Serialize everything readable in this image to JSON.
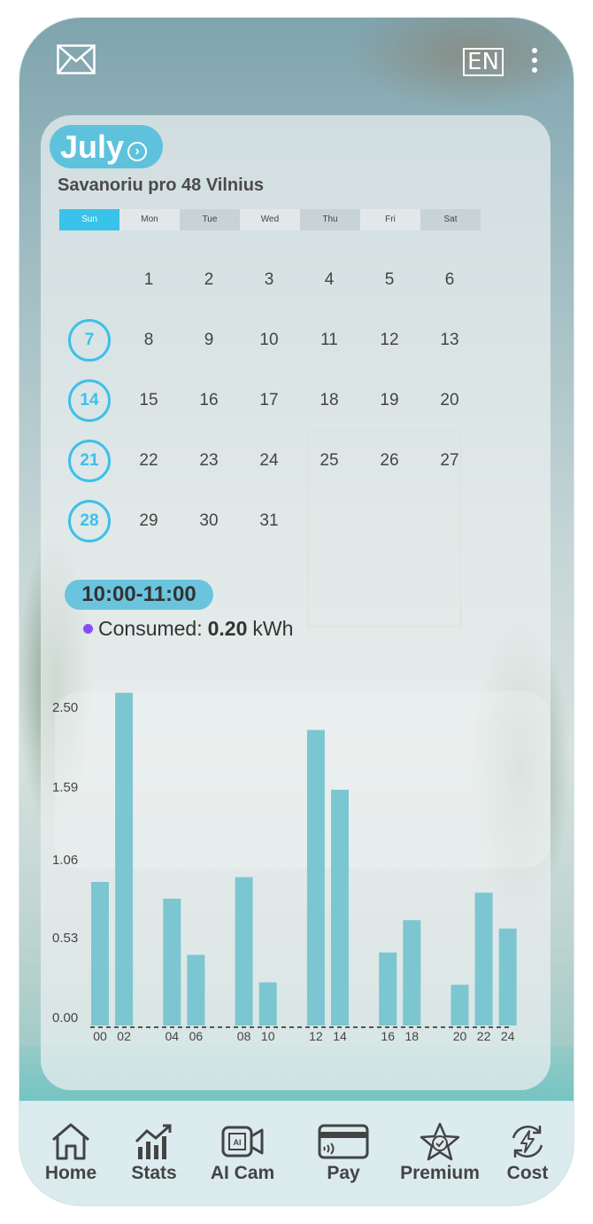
{
  "header": {
    "language": "EN"
  },
  "calendar": {
    "month": "July",
    "address": "Savanoriu pro 48 Vilnius",
    "weekdays": [
      "Sun",
      "Mon",
      "Tue",
      "Wed",
      "Thu",
      "Fri",
      "Sat"
    ],
    "weeks": [
      [
        "",
        "1",
        "2",
        "3",
        "4",
        "5",
        "6"
      ],
      [
        "7",
        "8",
        "9",
        "10",
        "11",
        "12",
        "13"
      ],
      [
        "14",
        "15",
        "16",
        "17",
        "18",
        "19",
        "20"
      ],
      [
        "21",
        "22",
        "23",
        "24",
        "25",
        "26",
        "27"
      ],
      [
        "28",
        "29",
        "30",
        "31",
        "",
        "",
        ""
      ]
    ],
    "highlighted_days": [
      "7",
      "14",
      "21",
      "28"
    ]
  },
  "usage": {
    "time_range": "10:00-11:00",
    "consumed_label": "Consumed:",
    "consumed_value": "0.20",
    "consumed_unit": "kWh",
    "consumed_color": "#8a4cf7"
  },
  "chart_data": {
    "type": "bar",
    "y_ticks": [
      "2.50",
      "1.59",
      "1.06",
      "0.53",
      "0.00"
    ],
    "x_tick_labels": [
      "00",
      "02",
      "04",
      "06",
      "08",
      "10",
      "12",
      "14",
      "16",
      "18",
      "20",
      "22",
      "24"
    ],
    "x": [
      0,
      1,
      3,
      4,
      6,
      7,
      9,
      10,
      12,
      13,
      15,
      16,
      17
    ],
    "values": [
      1.2,
      2.78,
      1.06,
      0.59,
      1.24,
      0.36,
      2.47,
      1.97,
      0.61,
      0.88,
      0.34,
      1.11,
      0.81
    ],
    "bar_color": "#7cc6d1",
    "grid": false
  },
  "nav": {
    "items": [
      {
        "label": "Home",
        "icon": "home-icon"
      },
      {
        "label": "Stats",
        "icon": "stats-icon"
      },
      {
        "label": "AI Cam",
        "icon": "ai-camera-icon"
      },
      {
        "label": "Pay",
        "icon": "credit-card-icon"
      },
      {
        "label": "Premium",
        "icon": "star-badge-icon"
      },
      {
        "label": "Cost",
        "icon": "energy-cycle-icon"
      }
    ]
  }
}
